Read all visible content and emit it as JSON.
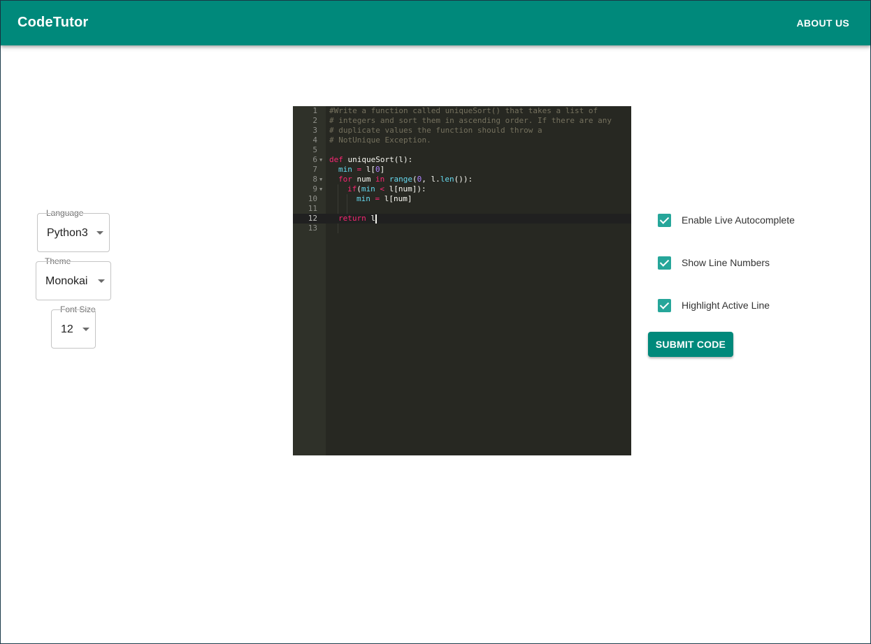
{
  "appbar": {
    "brand": "CodeTutor",
    "about": "ABOUT US"
  },
  "controls": {
    "language": {
      "legend": "Language",
      "value": "Python3"
    },
    "theme": {
      "legend": "Theme",
      "value": "Monokai"
    },
    "font_size": {
      "legend": "Font Size",
      "value": "12"
    }
  },
  "editor": {
    "line_numbers": [
      "1",
      "2",
      "3",
      "4",
      "5",
      "6",
      "7",
      "8",
      "9",
      "10",
      "11",
      "12",
      "13"
    ],
    "lines": {
      "l1": "#Write a function called uniqueSort() that takes a list of",
      "l2": "# integers and sort them in ascending order. If there are any",
      "l3": "# duplicate values the function should throw a",
      "l4": "# NotUnique Exception.",
      "l6_kw": "def",
      "l6_rest": " uniqueSort(l):",
      "l7_var": "min",
      "l7_op": " = ",
      "l7_a": "l[",
      "l7_num": "0",
      "l7_b": "]",
      "l8_kw": "for",
      "l8_a": " num ",
      "l8_in": "in",
      "l8_sp": " ",
      "l8_range": "range",
      "l8_b": "(",
      "l8_num": "0",
      "l8_c": ", l.",
      "l8_len": "len",
      "l8_d": "()):",
      "l9_kw": "if",
      "l9_a": "(",
      "l9_var": "min",
      "l9_op": " < ",
      "l9_b": "l[num]):",
      "l10_var": "min",
      "l10_op": " = ",
      "l10_b": "l[num]",
      "l12_kw": "return",
      "l12_b": " l"
    }
  },
  "options": {
    "autocomplete": {
      "label": "Enable Live Autocomplete",
      "checked": true
    },
    "line_numbers": {
      "label": "Show Line Numbers",
      "checked": true
    },
    "highlight": {
      "label": "Highlight Active Line",
      "checked": true
    }
  },
  "submit_label": "SUBMIT CODE",
  "colors": {
    "primary": "#00897b",
    "checkbox": "#26a69a",
    "editor_bg": "#272822"
  }
}
